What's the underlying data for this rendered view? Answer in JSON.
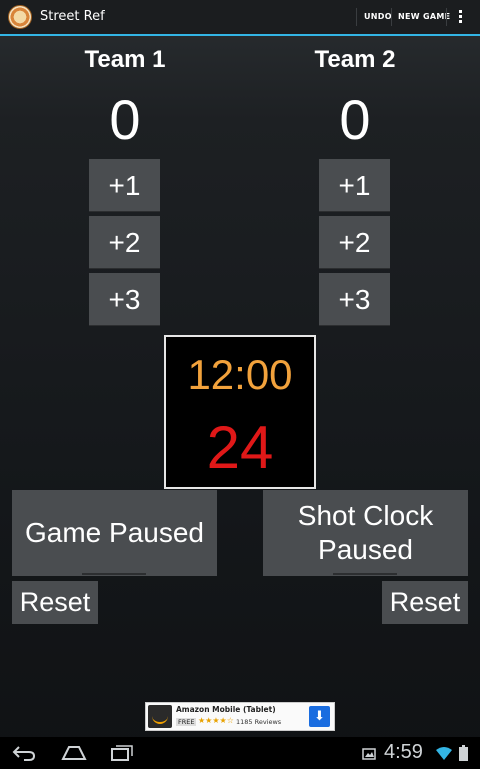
{
  "actionbar": {
    "title": "Street Ref",
    "undo_label": "UNDO",
    "new_game_label": "NEW GAME"
  },
  "teams": [
    {
      "name": "Team 1",
      "score": "0"
    },
    {
      "name": "Team 2",
      "score": "0"
    }
  ],
  "point_buttons": [
    "+1",
    "+2",
    "+3"
  ],
  "clock": {
    "game_time": "12:00",
    "shot_clock": "24",
    "game_time_color": "#f2a23c",
    "shot_clock_color": "#e01818"
  },
  "controls": {
    "game_toggle_label": "Game Paused",
    "shot_toggle_label": "Shot Clock Paused",
    "reset_label": "Reset"
  },
  "ad": {
    "title": "Amazon Mobile (Tablet)",
    "price": "FREE",
    "stars": "★★★★☆",
    "reviews": "1185 Reviews"
  },
  "statusbar": {
    "time": "4:59"
  },
  "colors": {
    "accent": "#33b5e5",
    "button_bg": "#4a4d50"
  }
}
